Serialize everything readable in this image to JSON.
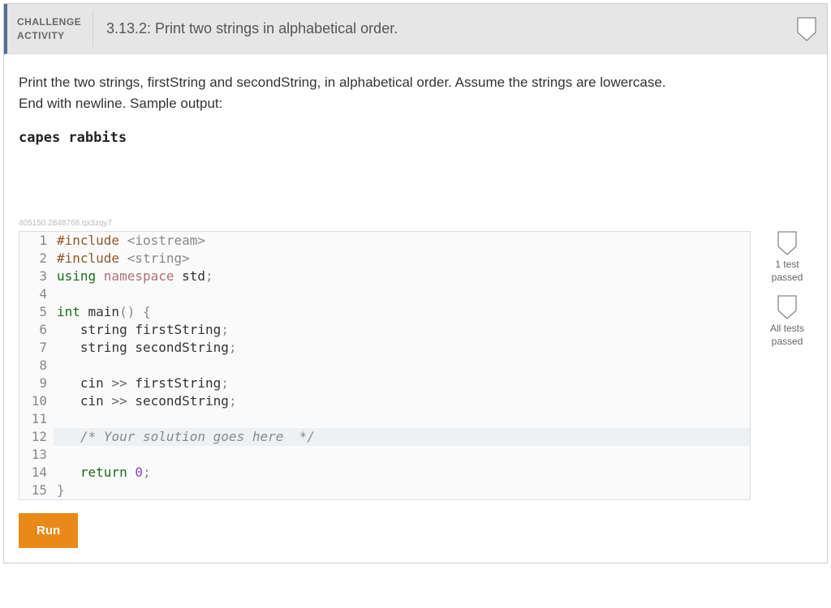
{
  "header": {
    "label_line1": "CHALLENGE",
    "label_line2": "ACTIVITY",
    "title": "3.13.2: Print two strings in alphabetical order."
  },
  "prompt": {
    "line1": "Print the two strings, firstString and secondString, in alphabetical order. Assume the strings are lowercase.",
    "line2": "End with newline. Sample output:"
  },
  "sample_output": "capes rabbits",
  "meta_id": "405150.2848768.qx3zqy7",
  "code": {
    "lines": [
      {
        "n": 1
      },
      {
        "n": 2
      },
      {
        "n": 3
      },
      {
        "n": 4
      },
      {
        "n": 5
      },
      {
        "n": 6
      },
      {
        "n": 7
      },
      {
        "n": 8
      },
      {
        "n": 9
      },
      {
        "n": 10
      },
      {
        "n": 11
      },
      {
        "n": 12,
        "hl": true
      },
      {
        "n": 13
      },
      {
        "n": 14
      },
      {
        "n": 15
      }
    ],
    "tok": {
      "l1_pp": "#include ",
      "l1_hdr": "<iostream>",
      "l2_pp": "#include ",
      "l2_hdr": "<string>",
      "l3_kw": "using ",
      "l3_ns": "namespace ",
      "l3_std": "std",
      "l3_sc": ";",
      "l5_kw": "int ",
      "l5_fn": "main",
      "l5_par": "() ",
      "l5_brace": "{",
      "l6_ind": "   ",
      "l6_type": "string ",
      "l6_id": "firstString",
      "l6_sc": ";",
      "l7_ind": "   ",
      "l7_type": "string ",
      "l7_id": "secondString",
      "l7_sc": ";",
      "l9_ind": "   ",
      "l9_cin": "cin ",
      "l9_op": ">> ",
      "l9_id": "firstString",
      "l9_sc": ";",
      "l10_ind": "   ",
      "l10_cin": "cin ",
      "l10_op": ">> ",
      "l10_id": "secondString",
      "l10_sc": ";",
      "l12_ind": "   ",
      "l12_cmt": "/* Your solution goes here  */",
      "l14_ind": "   ",
      "l14_kw": "return ",
      "l14_num": "0",
      "l14_sc": ";",
      "l15_brace": "}"
    }
  },
  "status": {
    "one_test": "1 test passed",
    "all_tests": "All tests passed"
  },
  "run_label": "Run"
}
